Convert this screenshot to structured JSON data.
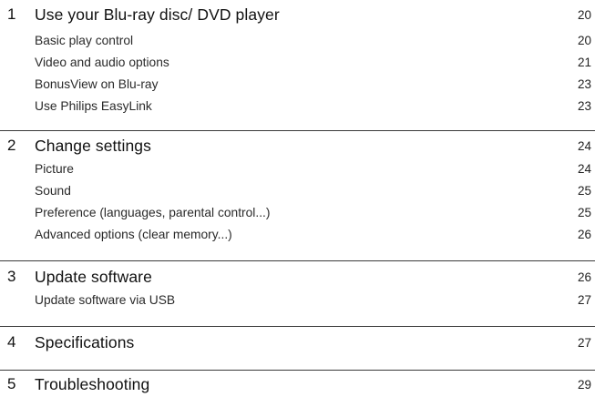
{
  "sections": [
    {
      "number": "1",
      "title": "Use your Blu-ray disc/ DVD player",
      "page": "20",
      "items": [
        {
          "label": "Basic play control",
          "page": "20"
        },
        {
          "label": "Video and audio options",
          "page": "21"
        },
        {
          "label": "BonusView on Blu-ray",
          "page": "23"
        },
        {
          "label": "Use Philips EasyLink",
          "page": "23"
        }
      ]
    },
    {
      "number": "2",
      "title": "Change settings",
      "page": "24",
      "items": [
        {
          "label": "Picture",
          "page": "24"
        },
        {
          "label": "Sound",
          "page": "25"
        },
        {
          "label": "Preference (languages, parental control...)",
          "page": "25"
        },
        {
          "label": "Advanced options (clear memory...)",
          "page": "26"
        }
      ]
    },
    {
      "number": "3",
      "title": "Update software",
      "page": "26",
      "items": [
        {
          "label": "Update software via USB",
          "page": "27"
        }
      ]
    },
    {
      "number": "4",
      "title": "Specifications",
      "page": "27",
      "items": []
    },
    {
      "number": "5",
      "title": "Troubleshooting",
      "page": "29",
      "items": []
    }
  ]
}
